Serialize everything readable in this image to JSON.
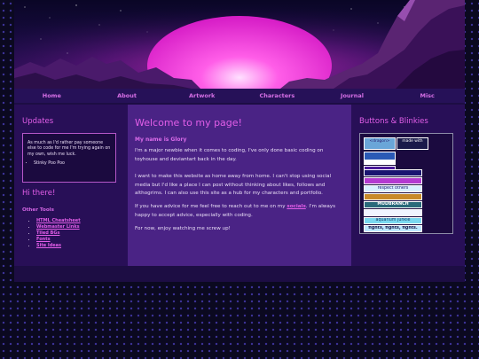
{
  "nav": [
    "Home",
    "About",
    "Artwork",
    "Characters",
    "Journal",
    "Misc"
  ],
  "left": {
    "updates_title": "Updates",
    "update_text": "As much as I'd rather pay someone else to code for me I'm trying again on my own, wish me luck.",
    "update_items": [
      "Stinky Poo Poo"
    ],
    "hi_title": "Hi there!",
    "tools_title": "Other Tools",
    "tools": [
      "HTML Cheatsheet",
      "Webmaster Links",
      "Tiled BGs",
      "Fonts",
      "Site Ideas"
    ]
  },
  "main": {
    "title": "Welcome to my page!",
    "subtitle": "My name is Glory",
    "p1": "I'm a major newbie when it comes to coding, I've only done basic coding on toyhouse and deviantart back in the day.",
    "p2": "I want to make this website as home away from home. I can't stop using social media but I'd like a place I can post without thinking about likes, follows and althogrims. I can also use this site as a hub for my characters and portfolio.",
    "p3_before": "If you have advice for me feel free to reach out to me on my ",
    "p3_link": "socials",
    "p3_after": ". I'm always happy to accept advice, especially with coding.",
    "p4": "For now, enjoy watching me screw up!"
  },
  "right": {
    "title": "Buttons & Blinkies",
    "badges": [
      "<dragon>",
      "made with",
      "",
      "",
      ""
    ],
    "blinkies": [
      "",
      "",
      "respect others",
      "",
      "MUDBRANCH",
      "",
      "aquarium junkie",
      "fights, fights, fights."
    ]
  },
  "colors": {
    "accent": "#e25ee8",
    "page_bg": "#0b0920",
    "side_panel": "#280f57",
    "main_panel": "#4a2385"
  }
}
